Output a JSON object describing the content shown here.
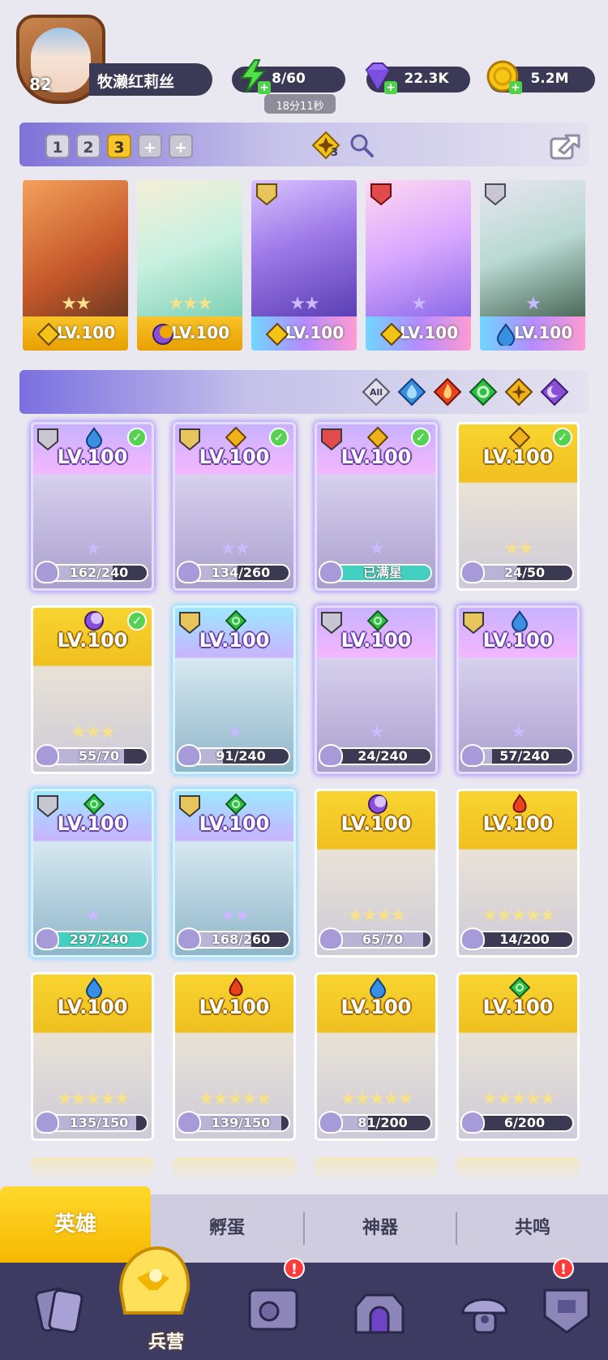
{
  "player": {
    "level": "82",
    "name": "牧濑红莉丝"
  },
  "resources": {
    "energy": "8/60",
    "energy_timer": "18分11秒",
    "gems": "22.3K",
    "coins": "5.2M"
  },
  "teams": {
    "tabs": [
      "1",
      "2",
      "3",
      "+",
      "+"
    ],
    "active": "3",
    "formation_badge": "3"
  },
  "team_heroes": [
    {
      "level": "LV.100",
      "stars": "★★",
      "frame": "gold",
      "element": "light"
    },
    {
      "level": "LV.100",
      "stars": "★★★",
      "frame": "gold",
      "element": "dark"
    },
    {
      "level": "LV.100",
      "stars": "★★",
      "frame": "rainbow",
      "element": "light",
      "rank": "III"
    },
    {
      "level": "LV.100",
      "stars": "★",
      "frame": "rainbow",
      "element": "light",
      "rank": "IV"
    },
    {
      "level": "LV.100",
      "stars": "★",
      "frame": "rainbow",
      "element": "water",
      "rank": "II"
    }
  ],
  "filters": [
    "All",
    "water",
    "fire",
    "wind",
    "light",
    "dark"
  ],
  "heroes": [
    {
      "level": "LV.100",
      "progress": "162/240",
      "fill": 0.675,
      "stars": "★",
      "frame": "purple",
      "element": "water",
      "rank": "II",
      "owned_check": true
    },
    {
      "level": "LV.100",
      "progress": "134/260",
      "fill": 0.515,
      "stars": "★★",
      "frame": "purple",
      "element": "light",
      "rank": "III",
      "owned_check": true
    },
    {
      "level": "LV.100",
      "progress": "已满星",
      "fill": 1,
      "stars": "★",
      "frame": "purple",
      "element": "light",
      "rank": "IV",
      "owned_check": true
    },
    {
      "level": "LV.100",
      "progress": "24/50",
      "fill": 0.48,
      "stars": "★★",
      "frame": "gold",
      "element": "light",
      "rank": "",
      "owned_check": true
    },
    {
      "level": "LV.100",
      "progress": "55/70",
      "fill": 0.786,
      "stars": "★★★",
      "frame": "gold",
      "element": "dark",
      "rank": "",
      "owned_check": true
    },
    {
      "level": "LV.100",
      "progress": "91/240",
      "fill": 0.379,
      "stars": "★",
      "frame": "blue",
      "element": "wind",
      "rank": "III",
      "owned_check": false
    },
    {
      "level": "LV.100",
      "progress": "24/240",
      "fill": 0.1,
      "stars": "★",
      "frame": "purple",
      "element": "wind",
      "rank": "II",
      "owned_check": false
    },
    {
      "level": "LV.100",
      "progress": "57/240",
      "fill": 0.238,
      "stars": "★",
      "frame": "purple",
      "element": "water",
      "rank": "III",
      "owned_check": false
    },
    {
      "level": "LV.100",
      "progress": "297/240",
      "fill": 1,
      "stars": "★",
      "frame": "blue",
      "element": "wind",
      "rank": "II",
      "owned_check": false
    },
    {
      "level": "LV.100",
      "progress": "168/260",
      "fill": 0.646,
      "stars": "★★",
      "frame": "blue",
      "element": "wind",
      "rank": "III",
      "owned_check": false
    },
    {
      "level": "LV.100",
      "progress": "65/70",
      "fill": 0.929,
      "stars": "★★★★",
      "frame": "gold",
      "element": "dark",
      "rank": "",
      "owned_check": false
    },
    {
      "level": "LV.100",
      "progress": "14/200",
      "fill": 0.07,
      "stars": "★★★★★",
      "frame": "gold",
      "element": "fire",
      "rank": "",
      "owned_check": false
    },
    {
      "level": "LV.100",
      "progress": "135/150",
      "fill": 0.9,
      "stars": "★★★★★",
      "frame": "gold",
      "element": "water",
      "rank": "",
      "owned_check": false
    },
    {
      "level": "LV.100",
      "progress": "139/150",
      "fill": 0.927,
      "stars": "★★★★★",
      "frame": "gold",
      "element": "fire",
      "rank": "",
      "owned_check": false
    },
    {
      "level": "LV.100",
      "progress": "81/200",
      "fill": 0.405,
      "stars": "★★★★★",
      "frame": "gold",
      "element": "water",
      "rank": "",
      "owned_check": false
    },
    {
      "level": "LV.100",
      "progress": "6/200",
      "fill": 0.03,
      "stars": "★★★★★",
      "frame": "gold",
      "element": "wind",
      "rank": "",
      "owned_check": false
    }
  ],
  "tabs": {
    "heroes": "英雄",
    "hatch": "孵蛋",
    "artifact": "神器",
    "resonance": "共鸣"
  },
  "nav": {
    "barracks_label": "兵营",
    "alert_mark": "!"
  },
  "colors": {
    "gold_frame": "#f4c51f",
    "purple_frame": "#b39ae8",
    "blue_frame": "#86c9f0",
    "water": "#3b8fe3",
    "fire": "#e8421f",
    "wind": "#2fbf46",
    "light": "#f0b21c",
    "dark": "#8a4fd8"
  }
}
